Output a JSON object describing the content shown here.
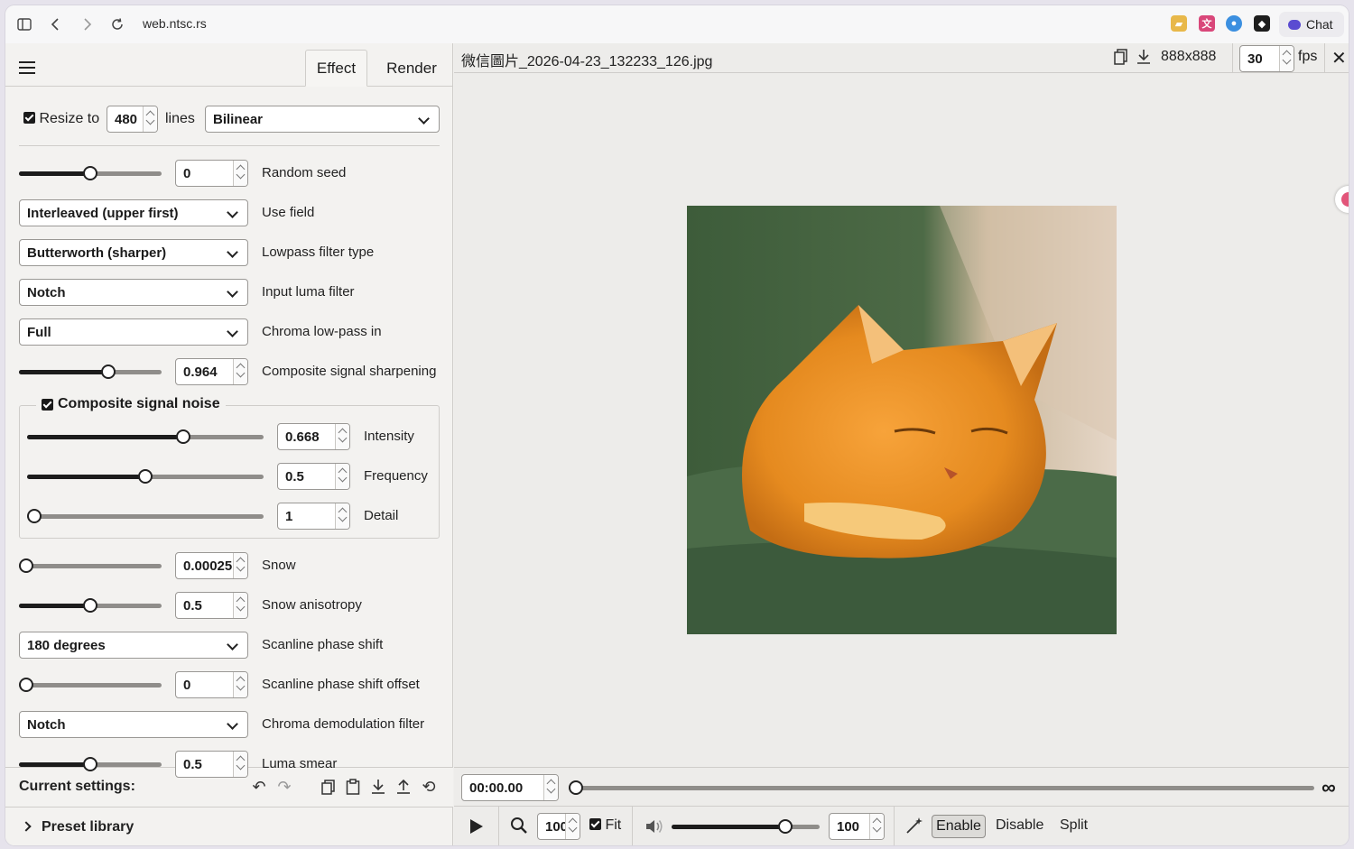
{
  "browser": {
    "url": "web.ntsc.rs",
    "chat_label": "Chat"
  },
  "tabs": {
    "effect": "Effect",
    "render": "Render"
  },
  "resize": {
    "label": "Resize to",
    "value": "480",
    "unit": "lines",
    "method": "Bilinear"
  },
  "settings": [
    {
      "kind": "slider",
      "value": "0",
      "label": "Random seed",
      "level": 0.5
    },
    {
      "kind": "select",
      "value": "Interleaved (upper first)",
      "label": "Use field"
    },
    {
      "kind": "select",
      "value": "Butterworth (sharper)",
      "label": "Lowpass filter type"
    },
    {
      "kind": "select",
      "value": "Notch",
      "label": "Input luma filter"
    },
    {
      "kind": "select",
      "value": "Full",
      "label": "Chroma low-pass in"
    },
    {
      "kind": "slider",
      "value": "0.964",
      "label": "Composite signal sharpening",
      "level": 0.64
    }
  ],
  "noise": {
    "title": "Composite signal noise",
    "items": [
      {
        "value": "0.668",
        "label": "Intensity",
        "level": 0.67
      },
      {
        "value": "0.5",
        "label": "Frequency",
        "level": 0.5
      },
      {
        "value": "1",
        "label": "Detail",
        "level": 0.0
      }
    ]
  },
  "settings2": [
    {
      "kind": "slider",
      "value": "0.00025",
      "label": "Snow",
      "level": 0.0
    },
    {
      "kind": "slider",
      "value": "0.5",
      "label": "Snow anisotropy",
      "level": 0.5
    },
    {
      "kind": "select",
      "value": "180 degrees",
      "label": "Scanline phase shift"
    },
    {
      "kind": "slider",
      "value": "0",
      "label": "Scanline phase shift offset",
      "level": 0.0
    },
    {
      "kind": "select",
      "value": "Notch",
      "label": "Chroma demodulation filter"
    },
    {
      "kind": "slider",
      "value": "0.5",
      "label": "Luma smear",
      "level": 0.5
    }
  ],
  "current_settings_label": "Current settings:",
  "preset_library_label": "Preset library",
  "viewer": {
    "filename": "微信圖片_2026-04-23_132233_126.jpg",
    "dimensions": "888x888",
    "fps_value": "30",
    "fps_label": "fps",
    "time": "00:00.00",
    "zoom": "100",
    "fit_label": "Fit",
    "volume": "100",
    "volume_level": 0.8,
    "enable_label": "Enable",
    "disable_label": "Disable",
    "split_label": "Split"
  }
}
